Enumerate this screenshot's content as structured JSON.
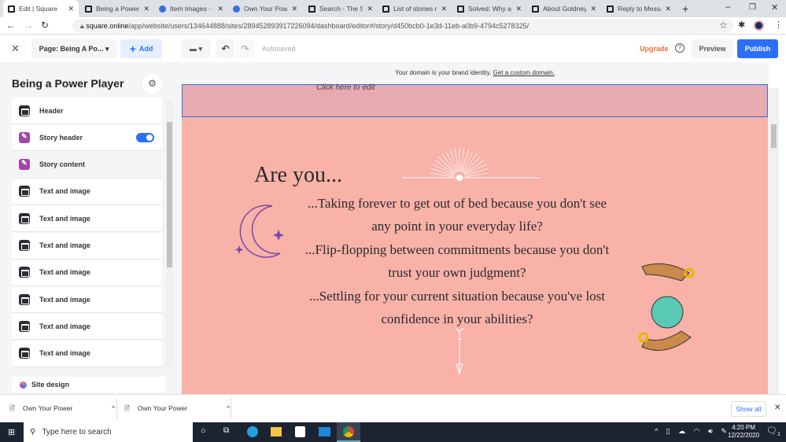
{
  "browser": {
    "tabs": [
      {
        "title": "Edit | Square",
        "icon": "square-icon",
        "active": true
      },
      {
        "title": "Being a Power Pl",
        "icon": "square-icon"
      },
      {
        "title": "Item Images - Cu",
        "icon": "canva-icon"
      },
      {
        "title": "Own Your Power",
        "icon": "canva-icon"
      },
      {
        "title": "Search - The Sel",
        "icon": "square-icon"
      },
      {
        "title": "List of stories no",
        "icon": "square-icon"
      },
      {
        "title": "Solved: Why are",
        "icon": "square-icon"
      },
      {
        "title": "About Goldneye",
        "icon": "square-icon"
      },
      {
        "title": "Reply to Messag",
        "icon": "square-icon"
      }
    ],
    "url_host": "square.online",
    "url_path": "/app/website/users/134644888/sites/289452893917226094/dashboard/editor#/story/d450bcb0-1e3d-11eb-a0b9-4794c5278325/"
  },
  "toolbar": {
    "page_select": "Page: Being A Po...",
    "add": "Add",
    "status": "Autosaved",
    "upgrade": "Upgrade",
    "preview": "Preview",
    "publish": "Publish",
    "accent": "#2b6ff5",
    "upgrade_color": "#f26b3a"
  },
  "sidebar": {
    "title": "Being a Power Player",
    "items": [
      {
        "label": "Header",
        "icon": "section-icon"
      },
      {
        "label": "Story header",
        "icon": "pencil-icon",
        "toggle": true
      },
      {
        "label": "Story content",
        "icon": "pencil-icon",
        "selected": true
      },
      {
        "label": "Text and image",
        "icon": "section-icon"
      },
      {
        "label": "Text and image",
        "icon": "section-icon"
      },
      {
        "label": "Text and image",
        "icon": "section-icon"
      },
      {
        "label": "Text and image",
        "icon": "section-icon"
      },
      {
        "label": "Text and image",
        "icon": "section-icon"
      },
      {
        "label": "Text and image",
        "icon": "section-icon"
      },
      {
        "label": "Text and image",
        "icon": "section-icon"
      }
    ],
    "site_design": "Site design"
  },
  "canvas": {
    "banner_text": "Your domain is your brand identity.",
    "banner_link": "Get a custom domain.",
    "click_to_edit": "Click here to edit",
    "heading": "Are you...",
    "lines": [
      "...Taking forever to get out of bed because you don't see",
      "any point in your everyday life?",
      "...Flip-flopping between commitments because you don't",
      "trust your own judgment?",
      "...Settling for your current situation because you've lost",
      "confidence in your abilities?"
    ],
    "bg": "#f8b2a8"
  },
  "downloads": {
    "items": [
      "Own Your Power",
      "Own Your Power"
    ],
    "show_all": "Show all"
  },
  "taskbar": {
    "search_placeholder": "Type here to search",
    "time": "4:20 PM",
    "date": "12/22/2020",
    "notifications": "1"
  }
}
